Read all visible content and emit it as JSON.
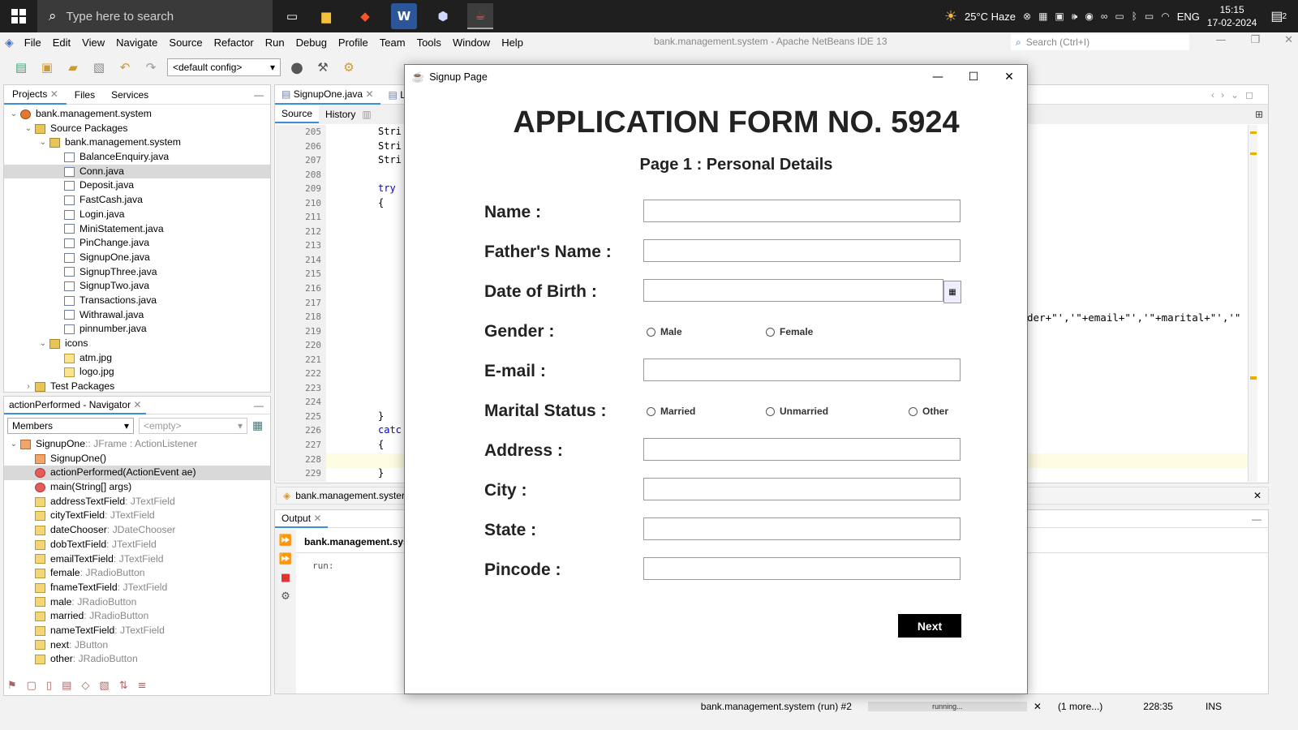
{
  "taskbar": {
    "search_placeholder": "Type here to search",
    "weather": "25°C  Haze",
    "language": "ENG",
    "time": "15:15",
    "date": "17-02-2024",
    "notifications": "2"
  },
  "ide": {
    "menu": [
      "File",
      "Edit",
      "View",
      "Navigate",
      "Source",
      "Refactor",
      "Run",
      "Debug",
      "Profile",
      "Team",
      "Tools",
      "Window",
      "Help"
    ],
    "title": "bank.management.system - Apache NetBeans IDE 13",
    "search_placeholder": "Search (Ctrl+I)",
    "config": "<default config>",
    "projects_tabs": [
      "Projects",
      "Files",
      "Services"
    ],
    "project_tree": [
      {
        "label": "bank.management.system",
        "type": "proj",
        "depth": 0
      },
      {
        "label": "Source Packages",
        "type": "folder",
        "depth": 1
      },
      {
        "label": "bank.management.system",
        "type": "pkg",
        "depth": 2
      },
      {
        "label": "BalanceEnquiry.java",
        "type": "java",
        "depth": 3
      },
      {
        "label": "Conn.java",
        "type": "java",
        "depth": 3,
        "selected": true
      },
      {
        "label": "Deposit.java",
        "type": "java",
        "depth": 3
      },
      {
        "label": "FastCash.java",
        "type": "java",
        "depth": 3
      },
      {
        "label": "Login.java",
        "type": "java",
        "depth": 3
      },
      {
        "label": "MiniStatement.java",
        "type": "java",
        "depth": 3
      },
      {
        "label": "PinChange.java",
        "type": "java",
        "depth": 3
      },
      {
        "label": "SignupOne.java",
        "type": "java",
        "depth": 3
      },
      {
        "label": "SignupThree.java",
        "type": "java",
        "depth": 3
      },
      {
        "label": "SignupTwo.java",
        "type": "java",
        "depth": 3
      },
      {
        "label": "Transactions.java",
        "type": "java",
        "depth": 3
      },
      {
        "label": "Withrawal.java",
        "type": "java",
        "depth": 3
      },
      {
        "label": "pinnumber.java",
        "type": "java",
        "depth": 3
      },
      {
        "label": "icons",
        "type": "pkg",
        "depth": 2
      },
      {
        "label": "atm.jpg",
        "type": "img",
        "depth": 3
      },
      {
        "label": "logo.jpg",
        "type": "img",
        "depth": 3
      },
      {
        "label": "Test Packages",
        "type": "folder",
        "depth": 1
      }
    ],
    "navigator_title": "actionPerformed - Navigator",
    "navigator_filter": "Members",
    "navigator_empty": "<empty>",
    "navigator_items": [
      {
        "name": "SignupOne",
        "type": " :: JFrame : ActionListener",
        "icon": "cls",
        "depth": 0
      },
      {
        "name": "SignupOne()",
        "type": "",
        "icon": "cls",
        "depth": 1
      },
      {
        "name": "actionPerformed(ActionEvent ae)",
        "type": "",
        "icon": "meth",
        "depth": 1,
        "selected": true
      },
      {
        "name": "main(String[] args)",
        "type": "",
        "icon": "meth",
        "depth": 1
      },
      {
        "name": "addressTextField",
        "type": " : JTextField",
        "icon": "fld",
        "depth": 1
      },
      {
        "name": "cityTextField",
        "type": " : JTextField",
        "icon": "fld",
        "depth": 1
      },
      {
        "name": "dateChooser",
        "type": " : JDateChooser",
        "icon": "fld",
        "depth": 1
      },
      {
        "name": "dobTextField",
        "type": " : JTextField",
        "icon": "fld",
        "depth": 1
      },
      {
        "name": "emailTextField",
        "type": " : JTextField",
        "icon": "fld",
        "depth": 1
      },
      {
        "name": "female",
        "type": " : JRadioButton",
        "icon": "fld",
        "depth": 1
      },
      {
        "name": "fnameTextField",
        "type": " : JTextField",
        "icon": "fld",
        "depth": 1
      },
      {
        "name": "male",
        "type": " : JRadioButton",
        "icon": "fld",
        "depth": 1
      },
      {
        "name": "married",
        "type": " : JRadioButton",
        "icon": "fld",
        "depth": 1
      },
      {
        "name": "nameTextField",
        "type": " : JTextField",
        "icon": "fld",
        "depth": 1
      },
      {
        "name": "next",
        "type": " : JButton",
        "icon": "fld",
        "depth": 1
      },
      {
        "name": "other",
        "type": " : JRadioButton",
        "icon": "fld",
        "depth": 1
      }
    ],
    "editor_tab": "SignupOne.java",
    "editor_tab2": "L",
    "source_tabs": [
      "Source",
      "History"
    ],
    "line_numbers": [
      "205",
      "206",
      "207",
      "208",
      "209",
      "210",
      "211",
      "212",
      "213",
      "214",
      "215",
      "216",
      "217",
      "218",
      "219",
      "220",
      "221",
      "222",
      "223",
      "224",
      "225",
      "226",
      "227",
      "228",
      "229"
    ],
    "code_lines": [
      "Stri",
      "Stri",
      "Stri",
      "",
      "try",
      "{",
      "",
      "",
      "",
      "",
      "",
      "",
      "",
      "",
      "",
      "",
      "",
      "",
      "",
      "",
      "}",
      "catc",
      "{",
      "",
      "}"
    ],
    "code_right": "der+\"','\"+email+\"','\"+marital+\"','\"",
    "breadcrumb": "bank.management.syster",
    "output_tab": "Output",
    "output_project": "bank.management.sys",
    "output_text": "run:",
    "status_run": "bank.management.system (run) #2",
    "status_progress": "running...",
    "status_more": "(1 more...)",
    "status_pos": "228:35",
    "status_mode": "INS"
  },
  "dialog": {
    "title": "Signup Page",
    "form_title": "APPLICATION FORM NO. 5924",
    "form_subtitle": "Page 1 : Personal Details",
    "labels": {
      "name": "Name :",
      "father": "Father's Name :",
      "dob": "Date of Birth :",
      "gender": "Gender :",
      "email": "E-mail :",
      "marital": "Marital Status :",
      "address": "Address :",
      "city": "City :",
      "state": "State :",
      "pincode": "Pincode :"
    },
    "gender_options": [
      "Male",
      "Female"
    ],
    "marital_options": [
      "Married",
      "Unmarried",
      "Other"
    ],
    "next_label": "Next"
  }
}
